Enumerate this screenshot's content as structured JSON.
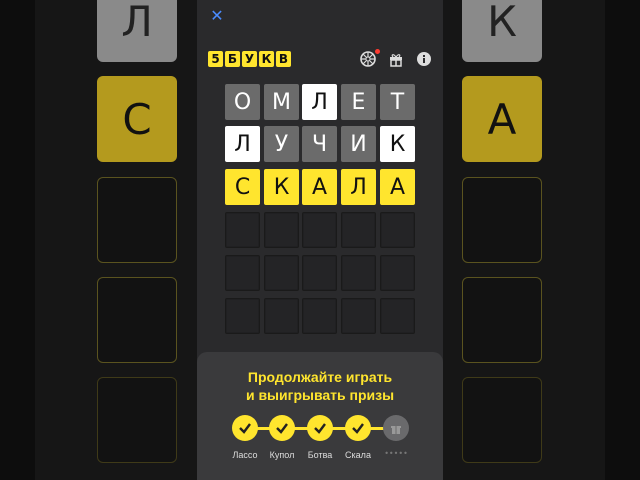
{
  "header": {
    "close_icon": "close-icon",
    "logo_letters": [
      "5",
      "Б",
      "У",
      "К",
      "В"
    ],
    "icons": [
      "wheel-icon",
      "gift-icon",
      "info-icon"
    ]
  },
  "board": {
    "rows": [
      [
        {
          "l": "О",
          "s": "gray"
        },
        {
          "l": "М",
          "s": "gray"
        },
        {
          "l": "Л",
          "s": "white"
        },
        {
          "l": "Е",
          "s": "gray"
        },
        {
          "l": "Т",
          "s": "gray"
        }
      ],
      [
        {
          "l": "Л",
          "s": "white"
        },
        {
          "l": "У",
          "s": "gray"
        },
        {
          "l": "Ч",
          "s": "gray"
        },
        {
          "l": "И",
          "s": "gray"
        },
        {
          "l": "К",
          "s": "white"
        }
      ],
      [
        {
          "l": "С",
          "s": "yellow"
        },
        {
          "l": "К",
          "s": "yellow"
        },
        {
          "l": "А",
          "s": "yellow"
        },
        {
          "l": "Л",
          "s": "yellow"
        },
        {
          "l": "А",
          "s": "yellow"
        }
      ],
      [
        {
          "l": "",
          "s": "empty"
        },
        {
          "l": "",
          "s": "empty"
        },
        {
          "l": "",
          "s": "empty"
        },
        {
          "l": "",
          "s": "empty"
        },
        {
          "l": "",
          "s": "empty"
        }
      ],
      [
        {
          "l": "",
          "s": "empty"
        },
        {
          "l": "",
          "s": "empty"
        },
        {
          "l": "",
          "s": "empty"
        },
        {
          "l": "",
          "s": "empty"
        },
        {
          "l": "",
          "s": "empty"
        }
      ],
      [
        {
          "l": "",
          "s": "empty"
        },
        {
          "l": "",
          "s": "empty"
        },
        {
          "l": "",
          "s": "empty"
        },
        {
          "l": "",
          "s": "empty"
        },
        {
          "l": "",
          "s": "empty"
        }
      ]
    ]
  },
  "side_left": {
    "letters": [
      "Л",
      "С"
    ]
  },
  "side_right": {
    "letters": [
      "К",
      "А"
    ]
  },
  "prizes": {
    "title_line1": "Продолжайте играть",
    "title_line2": "и выигрывать призы",
    "steps": [
      {
        "label": "Лассо",
        "done": true
      },
      {
        "label": "Купол",
        "done": true
      },
      {
        "label": "Ботва",
        "done": true
      },
      {
        "label": "Скала",
        "done": true
      },
      {
        "label": "•••••",
        "done": false
      }
    ]
  },
  "colors": {
    "accent": "#ffe52e",
    "gray_tile": "#6b6b6b",
    "white_tile": "#ffffff"
  }
}
